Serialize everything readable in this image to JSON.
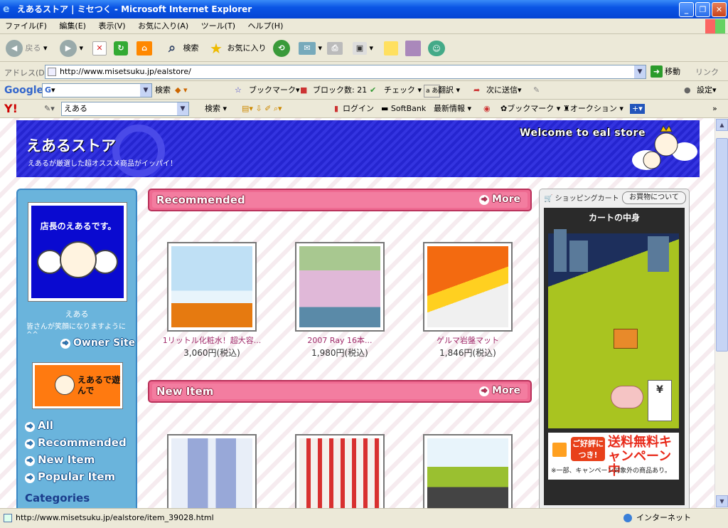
{
  "window": {
    "title": "えあるストア | ミセつく - Microsoft Internet Explorer",
    "minimize": "_",
    "maximize": "❐",
    "close": "✕"
  },
  "menu": [
    "ファイル(F)",
    "編集(E)",
    "表示(V)",
    "お気に入り(A)",
    "ツール(T)",
    "ヘルプ(H)"
  ],
  "toolbar": {
    "back": "戻る",
    "search": "検索",
    "favorites": "お気に入り"
  },
  "address": {
    "label": "アドレス(D)",
    "url": "http://www.misetsuku.jp/ealstore/",
    "go": "移動",
    "links": "リンク"
  },
  "google_bar": {
    "logo": "Google",
    "field_value": "G",
    "search": "検索",
    "bookmarks": "ブックマーク",
    "blocked": "ブロック数: 21",
    "check": "チェック",
    "translate": "翻訳",
    "send": "次に送信",
    "settings": "設定"
  },
  "yahoo_bar": {
    "logo": "Y!",
    "field_value": "えある",
    "search": "検索",
    "login": "ログイン",
    "softbank": "SoftBank",
    "news": "最新情報",
    "bookmarks": "ブックマーク",
    "auction": "オークション"
  },
  "page": {
    "header": {
      "logo": "えあるストア",
      "tagline": "えあるが厳選した超オススメ商品がイッパイ！",
      "welcome": "Welcome to eal store"
    },
    "left": {
      "avatar_caption": "店長のえあるです。",
      "name": "えある",
      "message": "皆さんが笑顔になりますように^^",
      "owner_site": "Owner Site",
      "play_banner": "えあるで遊んで",
      "nav": [
        "All",
        "Recommended",
        "New Item",
        "Popular Item"
      ],
      "categories": "Categories"
    },
    "sections": {
      "recommended": "Recommended",
      "new_item": "New Item",
      "more": "More"
    },
    "recommended_products": [
      {
        "name": "1リットル化粧水！超大容...",
        "price": "3,060円(税込)"
      },
      {
        "name": "2007 Ray 16本...",
        "price": "1,980円(税込)"
      },
      {
        "name": "ゲルマ岩盤マット",
        "price": "1,846円(税込)"
      }
    ],
    "cart": {
      "header": "ショッピングカート",
      "about_button": "お買物について",
      "title": "カートの中身",
      "ad_badge": "ご好評につき!",
      "ad_main": "送料無料キャンペーン中",
      "ad_note": "※一部、キャンペーン対象外の商品あり。"
    }
  },
  "status": {
    "url": "http://www.misetsuku.jp/ealstore/item_39028.html",
    "zone": "インターネット"
  }
}
